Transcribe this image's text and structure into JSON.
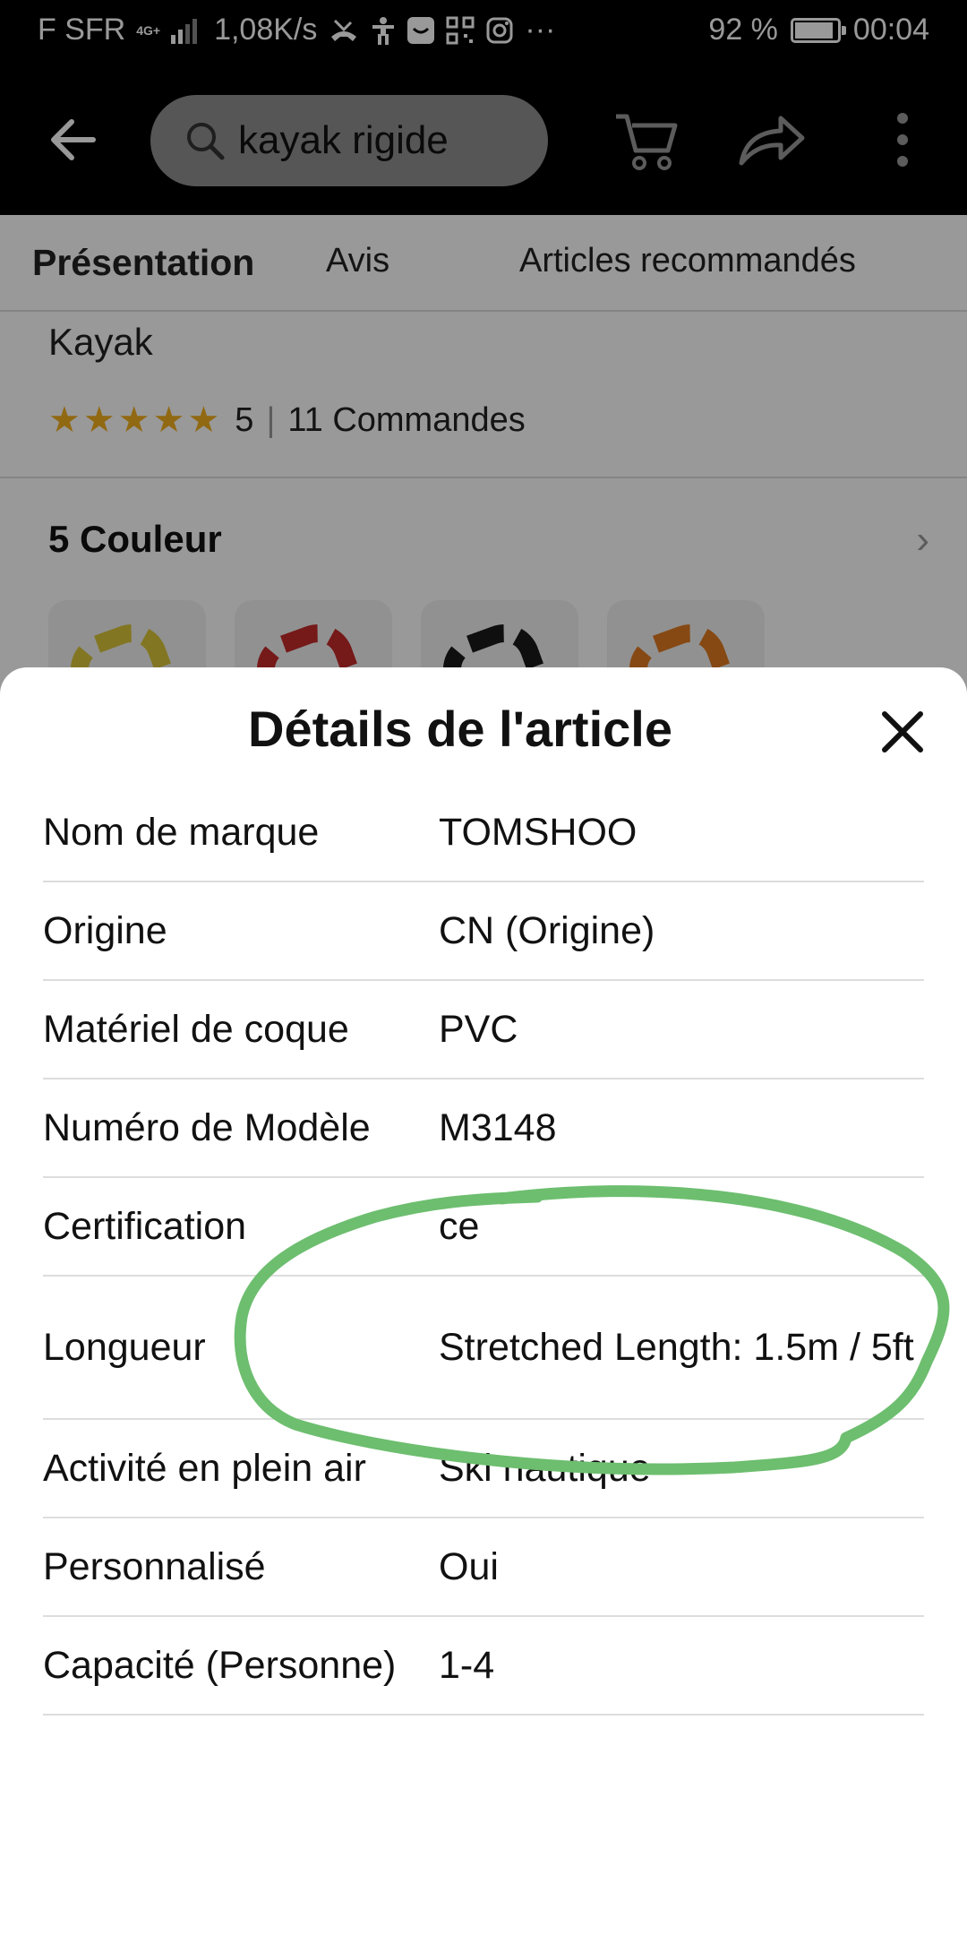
{
  "status_bar": {
    "carrier": "F SFR",
    "network": "4G+",
    "speed": "1,08K/s",
    "battery": "92 %",
    "battery_level": 0.92,
    "time": "00:04",
    "overflow": "···",
    "icons": [
      "missed-call-icon",
      "accessibility-icon",
      "shopping-app-icon",
      "qr-code-icon",
      "instagram-icon"
    ]
  },
  "header": {
    "search_text": "kayak rigide",
    "icons": [
      "back-arrow-icon",
      "search-icon",
      "cart-icon",
      "share-icon",
      "more-vert-icon"
    ]
  },
  "tabs": [
    {
      "label": "Présentation",
      "active": true
    },
    {
      "label": "Avis",
      "active": false
    },
    {
      "label": "Articles recommandés",
      "active": false
    }
  ],
  "product": {
    "title_fragment": "Kayak",
    "stars": "★★★★★",
    "rating": "5",
    "orders": "11 Commandes",
    "colors_label": "5 Couleur",
    "swatch_colors": [
      "#d9c53a",
      "#c42a2a",
      "#1a1a1a",
      "#e07a20"
    ]
  },
  "sheet": {
    "title": "Détails de l'article",
    "rows": [
      {
        "key": "Nom de marque",
        "value": "TOMSHOO"
      },
      {
        "key": "Origine",
        "value": "CN (Origine)"
      },
      {
        "key": "Matériel de coque",
        "value": "PVC"
      },
      {
        "key": "Numéro de Modèle",
        "value": "M3148"
      },
      {
        "key": "Certification",
        "value": "ce"
      },
      {
        "key": "Longueur",
        "value": "Stretched Length: 1.5m / 5ft"
      },
      {
        "key": "Activité en plein air",
        "value": "Ski nautique"
      },
      {
        "key": "Personnalisé",
        "value": "Oui"
      },
      {
        "key": "Capacité (Personne)",
        "value": "1-4"
      }
    ]
  },
  "annotation_color": "#6dbe6f"
}
